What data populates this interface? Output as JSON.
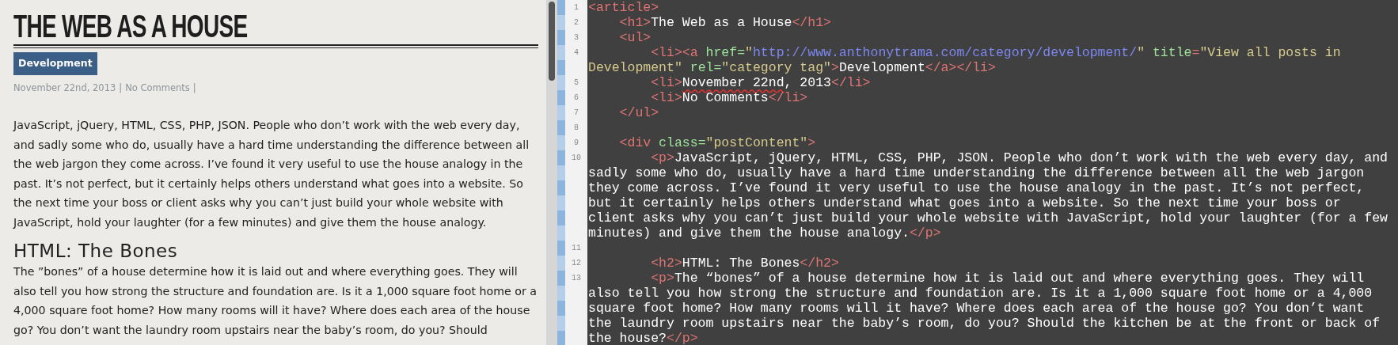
{
  "preview": {
    "title": "THE WEB AS A HOUSE",
    "category": "Development",
    "meta": [
      {
        "kind": "date",
        "text": "November 22nd, 2013"
      },
      {
        "kind": "separator",
        "text": "|"
      },
      {
        "kind": "link",
        "text": "No Comments"
      },
      {
        "kind": "separator",
        "text": "|"
      }
    ],
    "blocks": [
      {
        "kind": "paragraph",
        "text": "JavaScript, jQuery, HTML, CSS, PHP, JSON. People who don’t work with the web every day, and sadly some who do, usually have a hard time understanding the difference between all the web jargon they come across. I’ve found it very useful to use the house analogy in the past. It’s not perfect, but it certainly helps others understand what goes into a website. So the next time your boss or client asks why you can’t just build your whole website with JavaScript, hold your laughter (for a few minutes) and give them the house analogy."
      },
      {
        "kind": "heading",
        "text": "HTML: The Bones"
      },
      {
        "kind": "paragraph",
        "text": "The ”bones” of a house determine how it is laid out and where everything goes. They will also tell you how strong the structure and foundation are. Is it a 1,000 square foot home or a 4,000 square foot home? How many rooms will it have? Where does each area of the house go? You don’t want the laundry room upstairs near the baby’s room, do you? Should"
      }
    ]
  },
  "editor": {
    "rows": [
      {
        "number": "1",
        "tokens": [
          {
            "kind": "tag",
            "text": "<article>"
          }
        ]
      },
      {
        "number": "2",
        "tokens": [
          {
            "kind": "tag",
            "text": "    <h1>"
          },
          {
            "kind": "text",
            "text": "The Web as a House"
          },
          {
            "kind": "tag",
            "text": "</h1>"
          }
        ]
      },
      {
        "number": "3",
        "tokens": [
          {
            "kind": "tag",
            "text": "    <ul>"
          }
        ]
      },
      {
        "number": "4",
        "tokens": [
          {
            "kind": "tag",
            "text": "        <li><a"
          },
          {
            "kind": "attr",
            "text": " href="
          },
          {
            "kind": "string",
            "text": "\""
          },
          {
            "kind": "url",
            "text": "http://www.anthonytrama.com/category/development/"
          },
          {
            "kind": "string",
            "text": "\""
          },
          {
            "kind": "attr",
            "text": " title"
          },
          {
            "kind": "tag",
            "text": "="
          },
          {
            "kind": "string",
            "text": "\"View all posts in"
          }
        ]
      },
      {
        "tokens": [
          {
            "kind": "string",
            "text": "Development\""
          },
          {
            "kind": "attr",
            "text": " rel="
          },
          {
            "kind": "string",
            "text": "\"category tag\""
          },
          {
            "kind": "tag",
            "text": ">"
          },
          {
            "kind": "text",
            "text": "Development"
          },
          {
            "kind": "tag",
            "text": "</a></li>"
          }
        ]
      },
      {
        "number": "5",
        "tokens": [
          {
            "kind": "tag",
            "text": "        <li>"
          },
          {
            "kind": "misspelled",
            "text": "November 22nd"
          },
          {
            "kind": "text",
            "text": ", 2013"
          },
          {
            "kind": "tag",
            "text": "</li>"
          }
        ]
      },
      {
        "number": "6",
        "tokens": [
          {
            "kind": "tag",
            "text": "        <li>"
          },
          {
            "kind": "text",
            "text": "No Comments"
          },
          {
            "kind": "tag",
            "text": "</li>"
          }
        ]
      },
      {
        "number": "7",
        "tokens": [
          {
            "kind": "tag",
            "text": "    </ul>"
          }
        ]
      },
      {
        "number": "8"
      },
      {
        "number": "9",
        "tokens": [
          {
            "kind": "tag",
            "text": "    <div"
          },
          {
            "kind": "attr",
            "text": " class="
          },
          {
            "kind": "string",
            "text": "\"postContent\""
          },
          {
            "kind": "tag",
            "text": ">"
          }
        ]
      },
      {
        "number": "10",
        "tokens": [
          {
            "kind": "tag",
            "text": "        <p>"
          },
          {
            "kind": "text",
            "text": "JavaScript, jQuery, HTML, CSS, PHP, JSON. People who don’t work with the web every day, and"
          }
        ]
      },
      {
        "tokens": [
          {
            "kind": "text",
            "text": "sadly some who do, usually have a hard time understanding the difference between all the web jargon"
          }
        ]
      },
      {
        "tokens": [
          {
            "kind": "text",
            "text": "they come across. I’ve found it very useful to use the house analogy in the past. It’s not perfect,"
          }
        ]
      },
      {
        "tokens": [
          {
            "kind": "text",
            "text": "but it certainly helps others understand what goes into a website. So the next time your boss or"
          }
        ]
      },
      {
        "tokens": [
          {
            "kind": "text",
            "text": "client asks why you can’t just build your whole website with JavaScript, hold your laughter (for a few"
          }
        ]
      },
      {
        "tokens": [
          {
            "kind": "text",
            "text": "minutes) and give them the house analogy."
          },
          {
            "kind": "tag",
            "text": "</p>"
          }
        ]
      },
      {
        "number": "11"
      },
      {
        "number": "12",
        "tokens": [
          {
            "kind": "tag",
            "text": "        <h2>"
          },
          {
            "kind": "text",
            "text": "HTML: The Bones"
          },
          {
            "kind": "tag",
            "text": "</h2>"
          }
        ]
      },
      {
        "number": "13",
        "tokens": [
          {
            "kind": "tag",
            "text": "        <p>"
          },
          {
            "kind": "text",
            "text": "The “bones” of a house determine how it is laid out and where everything goes. They will"
          }
        ]
      },
      {
        "tokens": [
          {
            "kind": "text",
            "text": "also tell you how strong the structure and foundation are. Is it a 1,000 square foot home or a 4,000"
          }
        ]
      },
      {
        "tokens": [
          {
            "kind": "text",
            "text": "square foot home? How many rooms will it have? Where does each area of the house go? You don’t want"
          }
        ]
      },
      {
        "tokens": [
          {
            "kind": "text",
            "text": "the laundry room upstairs near the baby’s room, do you? Should the kitchen be at the front or back of"
          }
        ]
      },
      {
        "tokens": [
          {
            "kind": "text",
            "text": "the house?"
          },
          {
            "kind": "tag",
            "text": "</p>"
          }
        ]
      }
    ]
  }
}
